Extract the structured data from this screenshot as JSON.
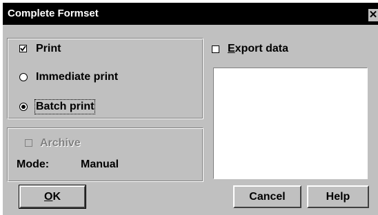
{
  "dialog": {
    "title": "Complete Formset",
    "close_glyph": "✕"
  },
  "print_group": {
    "print": {
      "label": "Print",
      "checked": true
    },
    "immediate": {
      "label": "Immediate print",
      "selected": false
    },
    "batch": {
      "label": "Batch print",
      "selected": true
    }
  },
  "archive_group": {
    "archive": {
      "label": "Archive",
      "checked": false,
      "enabled": false
    },
    "mode_label": "Mode:",
    "mode_value": "Manual"
  },
  "export": {
    "mnemonic": "E",
    "label_rest": "xport data",
    "checked": false
  },
  "buttons": {
    "ok_mnemonic": "O",
    "ok_rest": "K",
    "cancel": "Cancel",
    "help": "Help"
  },
  "colors": {
    "face": "#c0c0c0",
    "titlebar": "#000000",
    "disabled_text": "#808080"
  }
}
